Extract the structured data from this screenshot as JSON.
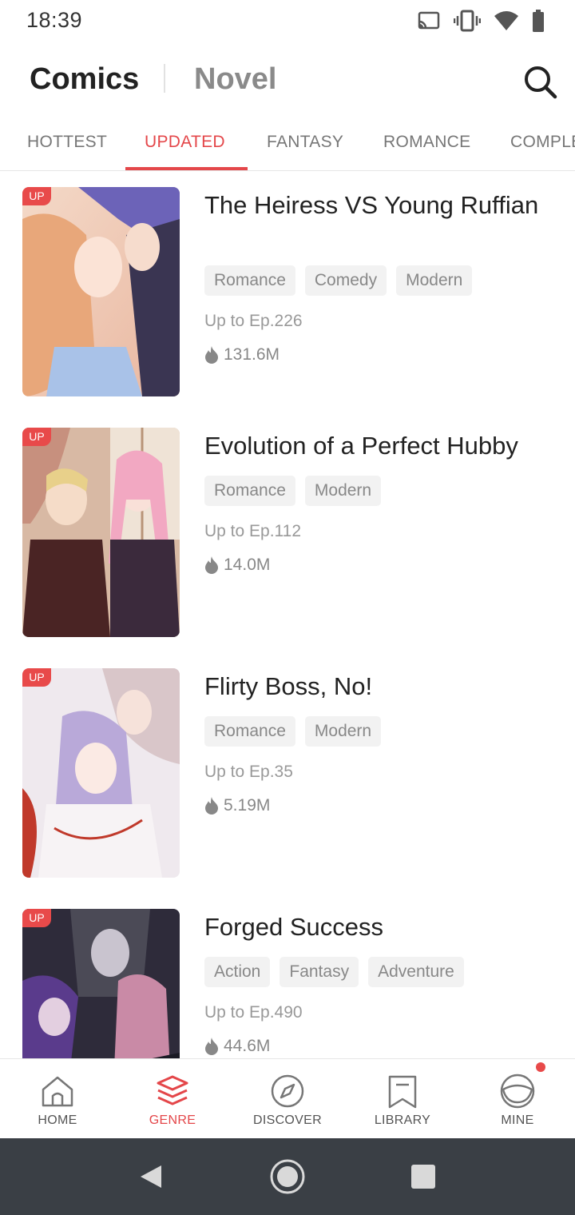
{
  "status_bar": {
    "time": "18:39"
  },
  "header": {
    "tab_comics": "Comics",
    "tab_novel": "Novel"
  },
  "tabs": [
    {
      "label": "HOTTEST",
      "active": false
    },
    {
      "label": "UPDATED",
      "active": true
    },
    {
      "label": "FANTASY",
      "active": false
    },
    {
      "label": "ROMANCE",
      "active": false
    },
    {
      "label": "COMPLE",
      "active": false
    }
  ],
  "items": [
    {
      "badge": "UP",
      "title": "The Heiress VS Young Ruffian",
      "tags": [
        "Romance",
        "Comedy",
        "Modern"
      ],
      "episode": "Up to Ep.226",
      "views": "131.6M"
    },
    {
      "badge": "UP",
      "title": "Evolution of a Perfect Hubby",
      "tags": [
        "Romance",
        "Modern"
      ],
      "episode": "Up to Ep.112",
      "views": "14.0M"
    },
    {
      "badge": "UP",
      "title": "Flirty Boss, No!",
      "tags": [
        "Romance",
        "Modern"
      ],
      "episode": "Up to Ep.35",
      "views": "5.19M"
    },
    {
      "badge": "UP",
      "title": "Forged Success",
      "tags": [
        "Action",
        "Fantasy",
        "Adventure"
      ],
      "episode": "Up to Ep.490",
      "views": "44.6M"
    }
  ],
  "bottom_nav": [
    {
      "label": "HOME",
      "icon": "home-icon",
      "active": false
    },
    {
      "label": "GENRE",
      "icon": "layers-icon",
      "active": true
    },
    {
      "label": "DISCOVER",
      "icon": "compass-icon",
      "active": false
    },
    {
      "label": "LIBRARY",
      "icon": "bookmark-icon",
      "active": false
    },
    {
      "label": "MINE",
      "icon": "profile-icon",
      "active": false
    }
  ],
  "colors": {
    "accent": "#e4474a",
    "tag_bg": "#f2f2f2",
    "system_nav_bg": "#3a3f45"
  }
}
